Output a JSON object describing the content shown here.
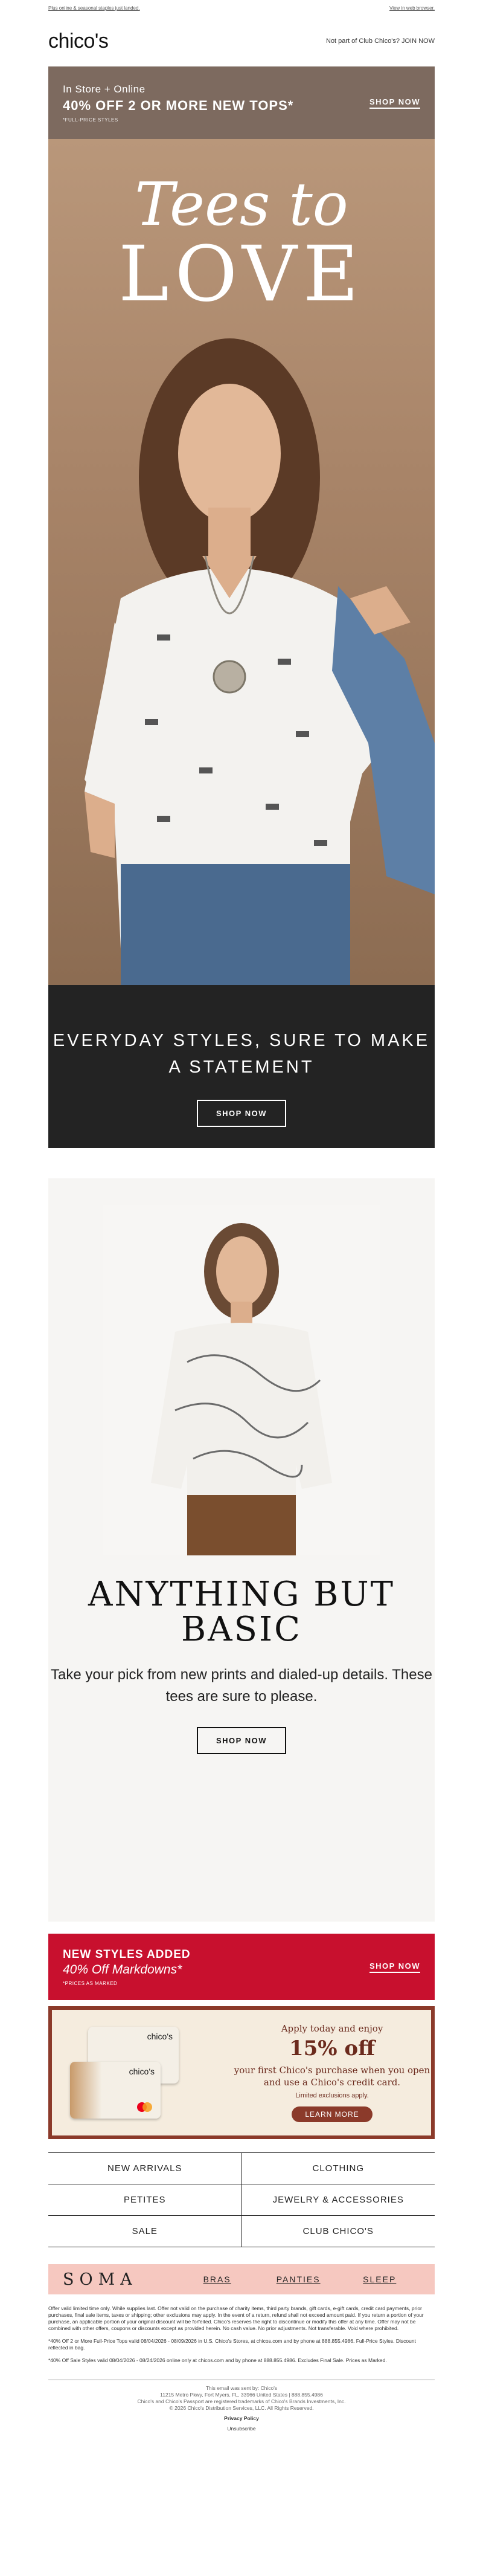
{
  "preheader": {
    "left": "Plus online & seasonal staples just landed.",
    "right": "View in web browser."
  },
  "header": {
    "logo": "chico's",
    "club_text": "Not part of Club Chico's? JOIN NOW"
  },
  "promo": {
    "line1": "In Store + Online",
    "line2": "40% OFF 2 OR MORE NEW TOPS*",
    "line3": "*FULL-PRICE STYLES",
    "cta": "SHOP NOW",
    "bg": "#7d6a5f"
  },
  "hero": {
    "title1": "Tees to",
    "title2": "LOVE",
    "band_text": "EVERYDAY STYLES, SURE TO MAKE A STATEMENT",
    "cta": "SHOP NOW"
  },
  "section2": {
    "headline": "ANYTHING BUT BASIC",
    "body": "Take your pick from new prints and dialed-up details. These tees are sure to please.",
    "cta": "SHOP NOW"
  },
  "redbar": {
    "line1": "NEW STYLES ADDED",
    "line2": "40% Off Markdowns*",
    "line3": "*PRICES AS MARKED",
    "cta": "SHOP NOW",
    "bg": "#c8102e"
  },
  "credit": {
    "line1": "Apply today and enjoy",
    "line2": "15% off",
    "line3": "your first Chico's purchase when you open and use a Chico's credit card.",
    "line4": "Limited exclusions apply.",
    "cta": "LEARN MORE",
    "card_name": "chico's"
  },
  "nav": [
    [
      "NEW ARRIVALS",
      "CLOTHING"
    ],
    [
      "PETITES",
      "JEWELRY & ACCESSORIES"
    ],
    [
      "SALE",
      "CLUB CHICO'S"
    ]
  ],
  "soma": {
    "brand": "SOMA",
    "links": [
      "BRAS",
      "PANTIES",
      "SLEEP"
    ]
  },
  "legal": {
    "p1": "Offer valid limited time only. While supplies last. Offer not valid on the purchase of charity items, third party brands, gift cards, e-gift cards, credit card payments, prior purchases, final sale items, taxes or shipping; other exclusions may apply. In the event of a return, refund shall not exceed amount paid. If you return a portion of your purchase, an applicable portion of your original discount will be forfeited. Chico's reserves the right to discontinue or modify this offer at any time. Offer may not be combined with other offers, coupons or discounts except as provided herein. No cash value. No prior adjustments. Not transferable. Void where prohibited.",
    "p2": "*40% Off 2 or More Full-Price Tops valid 08/04/2026 - 08/09/2026 in U.S. Chico's Stores, at chicos.com and by phone at 888.855.4986. Full-Price Styles. Discount reflected in bag.",
    "p3": "*40% Off Sale Styles valid 08/04/2026 - 08/24/2026 online only at chicos.com and by phone at 888.855.4986. Excludes Final Sale. Prices as Marked."
  },
  "footer": {
    "l1": "This email was sent by: Chico's",
    "l2": "11215 Metro Pkwy, Fort Myers, FL, 33966 United States | 888.855.4986",
    "l3": "Chico's and Chico's Passport are registered trademarks of Chico's Brands Investments, Inc.",
    "l4": "© 2026 Chico's Distribution Services, LLC. All Rights Reserved.",
    "privacy": "Privacy Policy",
    "unsubscribe": "Unsubscribe"
  }
}
